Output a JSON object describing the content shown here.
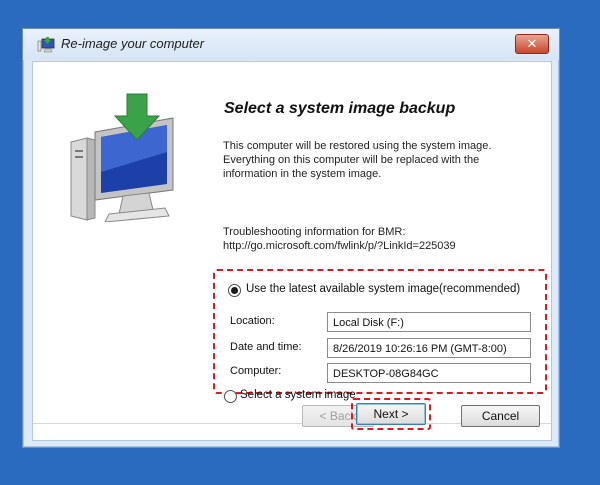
{
  "window": {
    "title": "Re-image your computer",
    "close_glyph": "✕"
  },
  "main": {
    "heading": "Select a system image backup",
    "description": "This computer will be restored using the system image. Everything on this computer will be replaced with the information in the system image.",
    "troubleshooting_label": "Troubleshooting information for BMR:",
    "troubleshooting_link": "http://go.microsoft.com/fwlink/p/?LinkId=225039",
    "option_latest": {
      "label": "Use the latest available system image(recommended)",
      "selected": true
    },
    "fields": {
      "location_label": "Location:",
      "location_value": "Local Disk (F:)",
      "datetime_label": "Date and time:",
      "datetime_value": "8/26/2019 10:26:16 PM (GMT-8:00)",
      "computer_label": "Computer:",
      "computer_value": "DESKTOP-08G84GC"
    },
    "option_select": {
      "label": "Select a system image",
      "selected": false
    }
  },
  "buttons": {
    "back_label": "< Back",
    "next_label": "Next >",
    "cancel_label": "Cancel"
  },
  "colors": {
    "desktop": "#2b6bbf",
    "highlight": "#e0181e",
    "close_button": "#c9462b"
  },
  "icons": {
    "title": "reimage-computer-icon",
    "illustration": "monitor-restore-icon"
  }
}
